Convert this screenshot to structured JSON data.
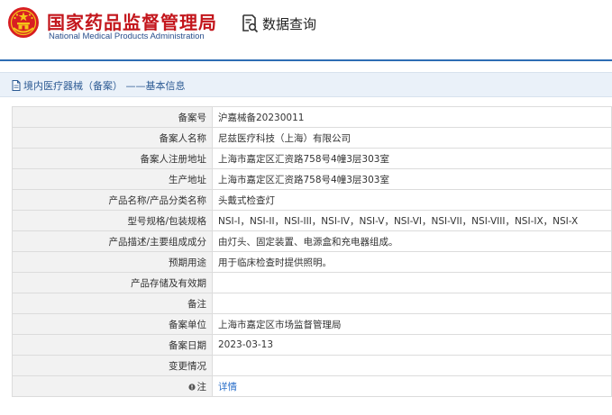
{
  "header": {
    "title_cn": "国家药品监督管理局",
    "title_en": "National Medical Products Administration",
    "query_label": "数据查询",
    "emblem_icon": "national-emblem-icon",
    "query_icon": "search-document-icon"
  },
  "breadcrumb": {
    "icon": "document-icon",
    "text": "境内医疗器械（备案） ——基本信息"
  },
  "fields": [
    {
      "label": "备案号",
      "value": "沪嘉械备20230011"
    },
    {
      "label": "备案人名称",
      "value": "尼兹医疗科技（上海）有限公司"
    },
    {
      "label": "备案人注册地址",
      "value": "上海市嘉定区汇资路758号4幢3层303室"
    },
    {
      "label": "生产地址",
      "value": "上海市嘉定区汇资路758号4幢3层303室"
    },
    {
      "label": "产品名称/产品分类名称",
      "value": "头戴式检查灯"
    },
    {
      "label": "型号规格/包装规格",
      "value": "NSI-I，NSI-II，NSI-III，NSI-IV，NSI-V，NSI-VI，NSI-VII，NSI-VIII，NSI-IX，NSI-X"
    },
    {
      "label": "产品描述/主要组成成分",
      "value": "由灯头、固定装置、电源盒和充电器组成。"
    },
    {
      "label": "预期用途",
      "value": "用于临床检查时提供照明。"
    },
    {
      "label": "产品存储及有效期",
      "value": ""
    },
    {
      "label": "备注",
      "value": ""
    },
    {
      "label": "备案单位",
      "value": "上海市嘉定区市场监督管理局"
    },
    {
      "label": "备案日期",
      "value": "2023-03-13"
    },
    {
      "label": "变更情况",
      "value": ""
    },
    {
      "label": "注",
      "value": "详情"
    }
  ],
  "colors": {
    "brand_red": "#c3161c",
    "brand_blue": "#2e6db4",
    "link_blue": "#2a6fc9",
    "label_bg": "#f2f2f2"
  }
}
